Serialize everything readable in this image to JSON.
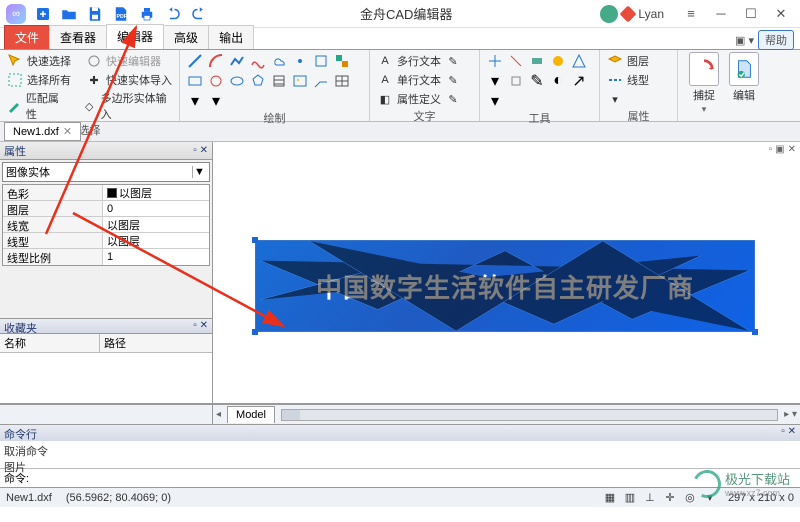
{
  "title": "金舟CAD编辑器",
  "username": "Lyan",
  "mainTabs": {
    "file": "文件",
    "viewer": "查看器",
    "editor": "编辑器",
    "advanced": "高级",
    "output": "输出"
  },
  "ribbon": {
    "sel": {
      "quick": "快速选择",
      "all": "选择所有",
      "match": "匹配属性",
      "qsel2": "快速编辑器",
      "import": "快速实体导入",
      "polyin": "多边形实体输入",
      "label": "选择"
    },
    "draw": "绘制",
    "text": {
      "multi": "多行文本",
      "single": "单行文本",
      "attr": "属性定义",
      "label": "文字"
    },
    "tools": "工具",
    "layer": {
      "layer": "图层",
      "ltype": "线型",
      "label": "属性"
    },
    "capture": "捕捉",
    "edit": "编辑",
    "help": "帮助"
  },
  "fileTab": "New1.dxf",
  "prop": {
    "header": "属性",
    "type": "图像实体",
    "rows": {
      "color": "色彩",
      "layer": "图层",
      "lw": "线宽",
      "lt": "线型",
      "lts": "线型比例"
    },
    "vals": {
      "color": "以图层",
      "layer": "0",
      "lw": "以图层",
      "lt": "以图层",
      "lts": "1"
    }
  },
  "fav": {
    "header": "收藏夹",
    "c1": "名称",
    "c2": "路径"
  },
  "modelTab": "Model",
  "cmd": {
    "header": "命令行",
    "out1": "取消命令",
    "out2": "图片",
    "label": "命令:"
  },
  "status": {
    "file": "New1.dxf",
    "coord": "(56.5962; 80.4069; 0)",
    "dims": "297 x 210 x 0"
  },
  "banner": "中国数字生活软件自主研发厂商",
  "watermark": {
    "name": "极光下载站",
    "url": "www.xz7.com"
  }
}
